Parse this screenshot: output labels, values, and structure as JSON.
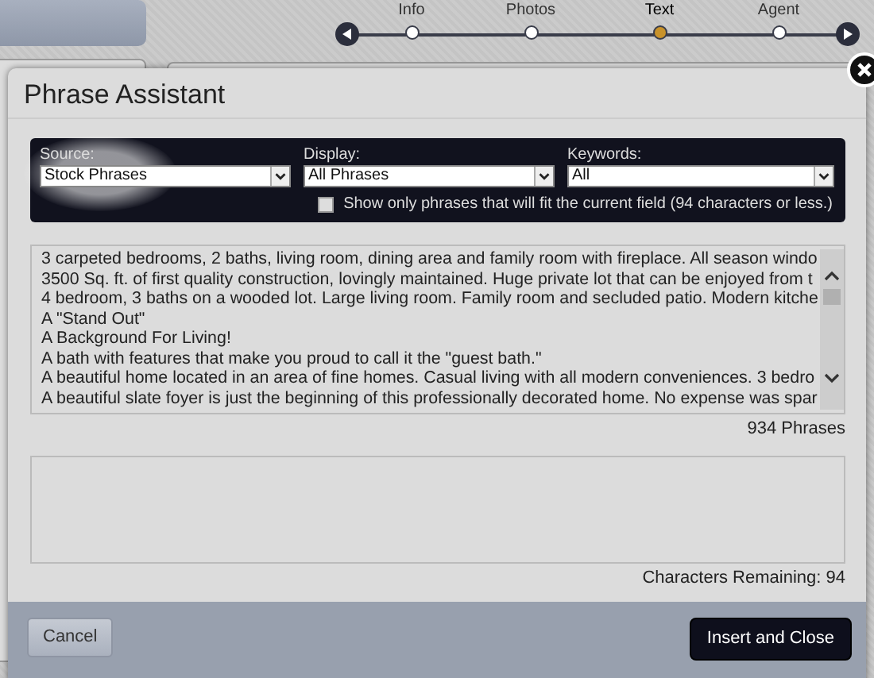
{
  "steps": [
    {
      "label": "Info",
      "selected": false
    },
    {
      "label": "Photos",
      "selected": false
    },
    {
      "label": "Text",
      "selected": true
    },
    {
      "label": "Agent",
      "selected": false
    }
  ],
  "dialog": {
    "title": "Phrase Assistant",
    "filters": [
      {
        "label": "Source:",
        "value": "Stock Phrases",
        "highlighted": true
      },
      {
        "label": "Display:",
        "value": "All Phrases",
        "highlighted": false
      },
      {
        "label": "Keywords:",
        "value": "All",
        "highlighted": false
      }
    ],
    "fit_option": {
      "label": "Show only phrases that will fit the current field (94 characters or less.)",
      "checked": false
    },
    "phrases": [
      "3 carpeted bedrooms, 2 baths, living room, dining area and family room with fireplace. All season windo",
      "3500 Sq. ft. of first quality construction, lovingly maintained. Huge private lot that can be enjoyed from t",
      "4 bedroom, 3 baths on a wooded lot. Large living room. Family room and secluded patio. Modern kitche",
      "A \"Stand Out\"",
      "A Background For Living!",
      "A bath with features that make you proud to call it the \"guest bath.\"",
      "A beautiful home located in an area of fine homes. Casual living with all modern conveniences. 3 bedro",
      "A beautiful slate foyer is just the beginning of this professionally decorated home. No expense was spar"
    ],
    "phrase_count": "934 Phrases",
    "characters_remaining": "Characters Remaining: 94",
    "buttons": [
      {
        "label": "Cancel",
        "kind": "secondary"
      },
      {
        "label": "Insert and Close",
        "kind": "primary"
      }
    ]
  }
}
